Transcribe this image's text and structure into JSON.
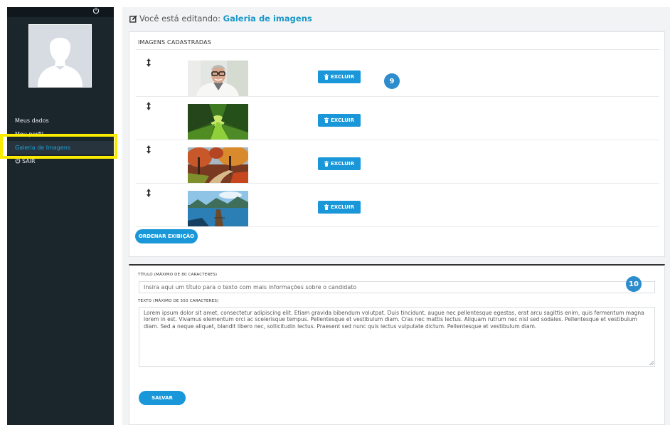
{
  "sidebar": {
    "items": [
      {
        "label": "Meus dados"
      },
      {
        "label": "Meu perfil"
      },
      {
        "label": "Galeria de Imagens"
      },
      {
        "label": "SAIR"
      }
    ]
  },
  "header": {
    "prefix": "Você está editando:",
    "section": "Galeria de imagens"
  },
  "gallery": {
    "heading": "IMAGENS CADASTRADAS",
    "items": [
      {
        "alt": "Foto de homem de óculos sorrindo",
        "delete_label": "EXCLUIR"
      },
      {
        "alt": "Caminho com túnel de árvores verdes",
        "delete_label": "EXCLUIR"
      },
      {
        "alt": "Trilha de outono com árvores coloridas",
        "delete_label": "EXCLUIR"
      },
      {
        "alt": "Píer sobre lago com montanhas",
        "delete_label": "EXCLUIR"
      }
    ],
    "order_button": "ORDENAR EXIBIÇÃO",
    "badge": "9"
  },
  "form": {
    "title_label": "TÍTULO (MÁXIMO DE 80 CARACTERES)",
    "title_value": "Insira aqui um título para o texto com mais informações sobre o candidato",
    "text_label": "TEXTO (MÁXIMO DE 550 CARACTERES)",
    "text_value": "Lorem ipsum dolor sit amet, consectetur adipiscing elit. Etiam gravida bibendum volutpat. Duis tincidunt, augue nec pellentesque egestas, erat arcu sagittis enim, quis fermentum magna lorem in est. Vivamus elementum orci ac scelerisque tempus. Pellentesque et vestibulum diam. Cras nec mattis lectus. Aliquam rutrum nec nisl sed sodales. Pellentesque et vestibulum diam. Sed a neque aliquet, blandit libero nec, sollicitudin lectus. Praesent sed nunc quis lectus vulputate dictum. Pellentesque et vestibulum diam.",
    "save_label": "SALVAR",
    "badge": "10"
  },
  "colors": {
    "accent": "#1a97d9",
    "sidebar": "#1b252c",
    "highlight": "#f8eb00",
    "badge": "#2c8ccc"
  },
  "icons": [
    "power-icon",
    "edit-icon",
    "drag-handle-icon",
    "trash-icon",
    "resize-handle-icon"
  ]
}
